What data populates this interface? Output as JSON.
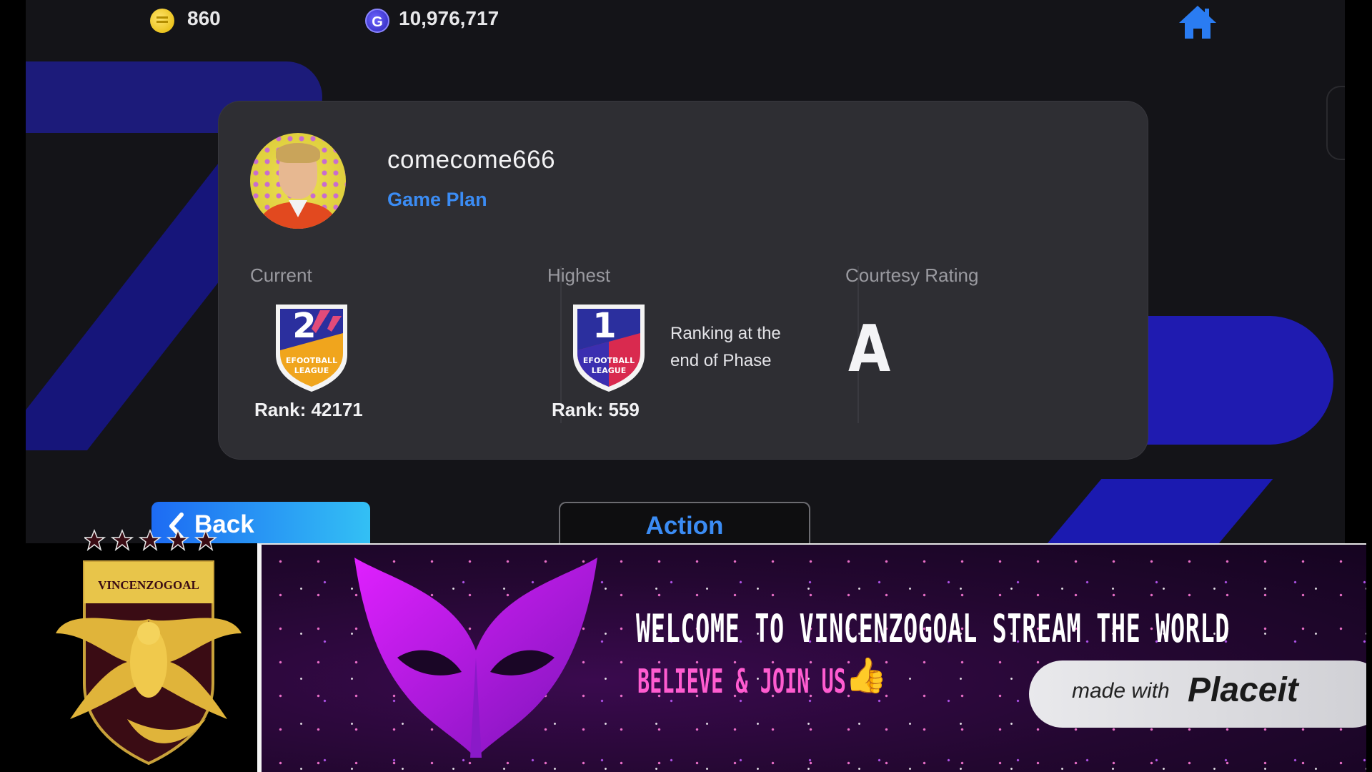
{
  "currency": {
    "coin_icon": "coin-icon",
    "coins": "860",
    "gp_icon": "gp-icon",
    "gp_letter": "G",
    "gp": "10,976,717"
  },
  "nav": {
    "home_icon": "home-icon"
  },
  "profile": {
    "username": "comecome666",
    "subtitle": "Game Plan"
  },
  "stats": {
    "current": {
      "label": "Current",
      "division": "2",
      "badge_text": "EFOOTBALL LEAGUE",
      "rank": "Rank: 42171"
    },
    "highest": {
      "label": "Highest",
      "division": "1",
      "badge_text": "EFOOTBALL LEAGUE",
      "rank": "Rank: 559",
      "note_line1": "Ranking at the",
      "note_line2": "end of Phase"
    },
    "courtesy": {
      "label": "Courtesy Rating",
      "grade": "A"
    }
  },
  "buttons": {
    "back": "Back",
    "action": "Action"
  },
  "overlay": {
    "logo_text": "VINCENZOGOAL",
    "welcome": "WELCOME TO VINCENZOGOAL STREAM THE WORLD",
    "believe": "BELIEVE & JOIN US",
    "thumb": "👍",
    "made_with": "made with",
    "brand": "Placeit"
  },
  "colors": {
    "accent_blue": "#3b8cf4",
    "card_bg": "#2e2e33",
    "banner_pink": "#ff5cd0"
  }
}
